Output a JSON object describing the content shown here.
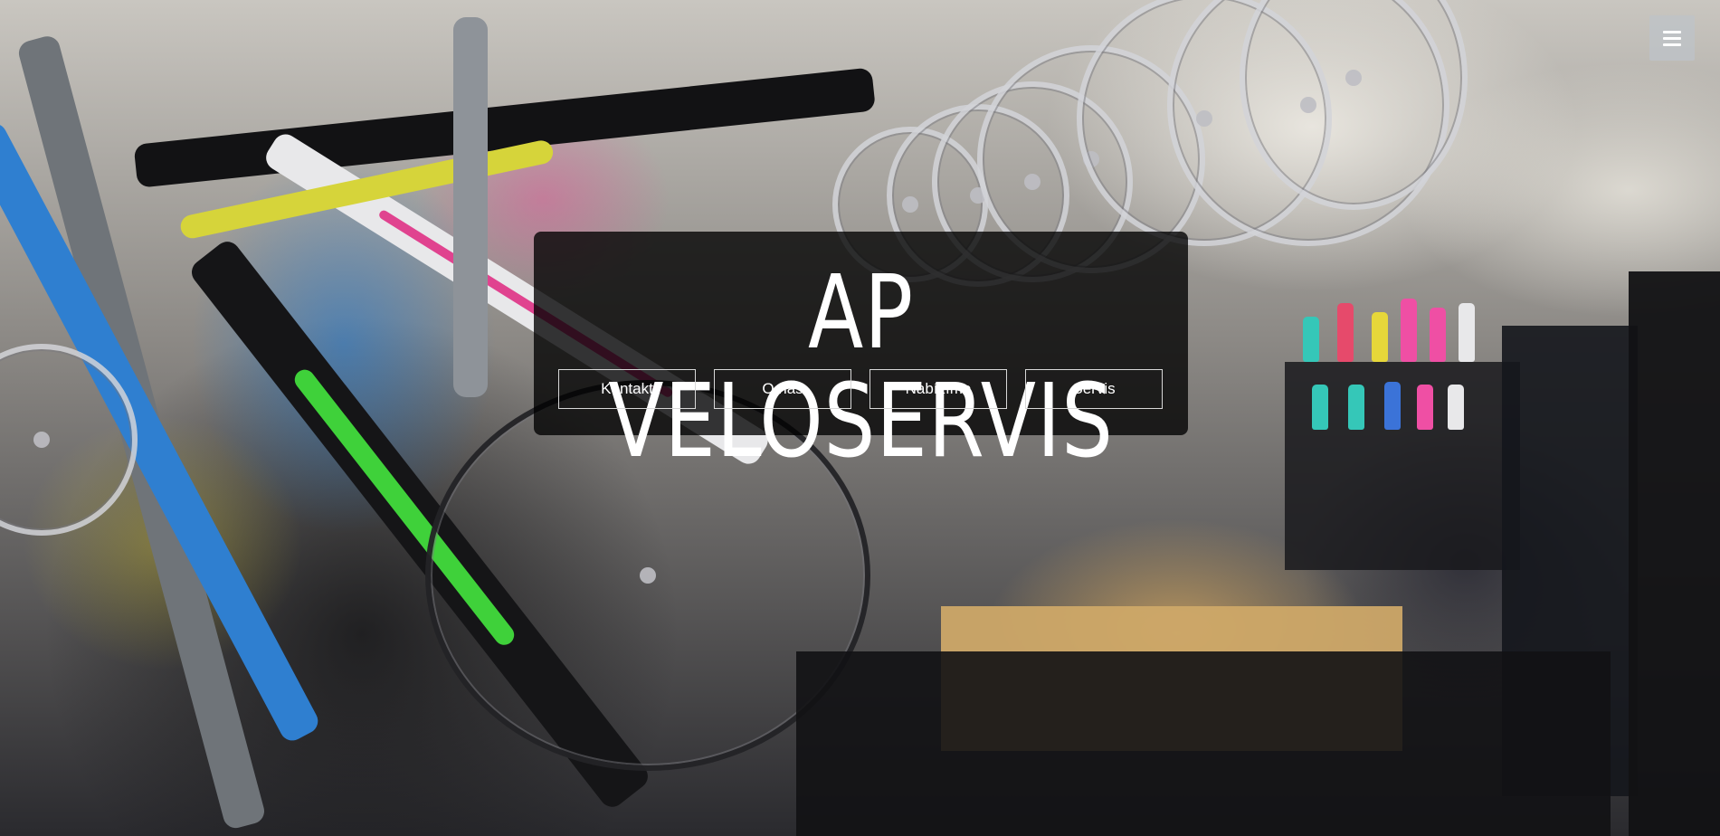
{
  "header": {
    "menu_icon": "hamburger-menu-icon"
  },
  "hero": {
    "title": "AP VELOSERVIS",
    "background": "bike-shop-photo"
  },
  "nav": {
    "items": [
      {
        "label": "Kontakt"
      },
      {
        "label": "O nás"
      },
      {
        "label": "Nabízíme"
      },
      {
        "label": "Servis"
      }
    ]
  },
  "colors": {
    "panel_bg": "#000000",
    "text": "#ffffff",
    "button_border": "#d8d8d8",
    "menu_button_bg": "#bec3c8"
  }
}
